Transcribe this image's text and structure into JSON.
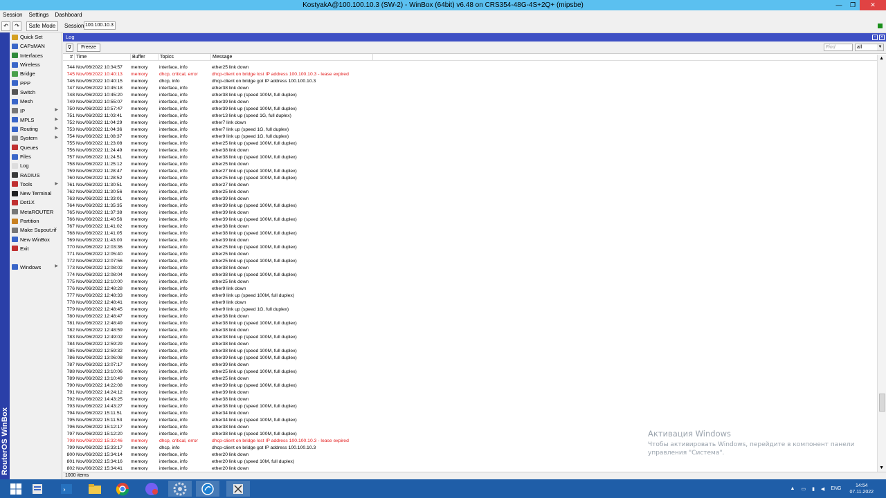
{
  "window": {
    "title": "KostyakA@100.100.10.3 (SW-2) - WinBox (64bit) v6.48 on CRS354-48G-4S+2Q+ (mipsbe)"
  },
  "menubar": [
    "Session",
    "Settings",
    "Dashboard"
  ],
  "toolbar": {
    "undo": "↶",
    "redo": "↷",
    "safe_mode": "Safe Mode",
    "session_label": "Session:",
    "session_value": "100.100.10.3"
  },
  "brand_vertical": "RouterOS WinBox",
  "sidebar": [
    {
      "label": "Quick Set",
      "color": "#d4a020",
      "arrow": false
    },
    {
      "label": "CAPsMAN",
      "color": "#3a66c8",
      "arrow": false
    },
    {
      "label": "Interfaces",
      "color": "#2f8a3a",
      "arrow": false
    },
    {
      "label": "Wireless",
      "color": "#3a66c8",
      "arrow": false
    },
    {
      "label": "Bridge",
      "color": "#4aa04a",
      "arrow": false
    },
    {
      "label": "PPP",
      "color": "#3a66c8",
      "arrow": false
    },
    {
      "label": "Switch",
      "color": "#555555",
      "arrow": false
    },
    {
      "label": "Mesh",
      "color": "#3a66c8",
      "arrow": false
    },
    {
      "label": "IP",
      "color": "#777777",
      "arrow": true
    },
    {
      "label": "MPLS",
      "color": "#3a66c8",
      "arrow": true
    },
    {
      "label": "Routing",
      "color": "#3a66c8",
      "arrow": true
    },
    {
      "label": "System",
      "color": "#888888",
      "arrow": true
    },
    {
      "label": "Queues",
      "color": "#c03030",
      "arrow": false
    },
    {
      "label": "Files",
      "color": "#3a66c8",
      "arrow": false
    },
    {
      "label": "Log",
      "color": "#dddddd",
      "arrow": false
    },
    {
      "label": "RADIUS",
      "color": "#3a3a3a",
      "arrow": false
    },
    {
      "label": "Tools",
      "color": "#c03030",
      "arrow": true
    },
    {
      "label": "New Terminal",
      "color": "#222222",
      "arrow": false
    },
    {
      "label": "Dot1X",
      "color": "#c03030",
      "arrow": false
    },
    {
      "label": "MetaROUTER",
      "color": "#777777",
      "arrow": false
    },
    {
      "label": "Partition",
      "color": "#c88020",
      "arrow": false
    },
    {
      "label": "Make Supout.rif",
      "color": "#777777",
      "arrow": false
    },
    {
      "label": "New WinBox",
      "color": "#3a66c8",
      "arrow": false
    },
    {
      "label": "Exit",
      "color": "#c03030",
      "arrow": false
    },
    {
      "label": "",
      "color": "",
      "arrow": false
    },
    {
      "label": "Windows",
      "color": "#3a66c8",
      "arrow": true
    }
  ],
  "log": {
    "title": "Log",
    "freeze": "Freeze",
    "find_placeholder": "Find",
    "filter_value": "all",
    "columns": [
      "#",
      "Time",
      "Buffer",
      "Topics",
      "Message"
    ],
    "rows": [
      [
        "744",
        "Nov/06/2022 10:34:57",
        "memory",
        "interface, info",
        "ether25  link down",
        false
      ],
      [
        "745",
        "Nov/06/2022 10:40:13",
        "memory",
        "dhcp, critical, error",
        "dhcp-client on bridge lost IP address 100.100.10.3 - lease expired",
        true
      ],
      [
        "746",
        "Nov/06/2022 10:40:15",
        "memory",
        "dhcp, info",
        "dhcp-client on bridge got IP address 100.100.10.3",
        false
      ],
      [
        "747",
        "Nov/06/2022 10:45:18",
        "memory",
        "interface, info",
        "ether38 link down",
        false
      ],
      [
        "748",
        "Nov/06/2022 10:45:20",
        "memory",
        "interface, info",
        "ether38 link up (speed 100M, full duplex)",
        false
      ],
      [
        "749",
        "Nov/06/2022 10:55:07",
        "memory",
        "interface, info",
        "ether39 link down",
        false
      ],
      [
        "750",
        "Nov/06/2022 10:57:47",
        "memory",
        "interface, info",
        "ether39 link up (speed 100M, full duplex)",
        false
      ],
      [
        "751",
        "Nov/06/2022 11:03:41",
        "memory",
        "interface, info",
        "ether13 link up (speed 1G, full duplex)",
        false
      ],
      [
        "752",
        "Nov/06/2022 11:04:29",
        "memory",
        "interface, info",
        "ether7 link down",
        false
      ],
      [
        "753",
        "Nov/06/2022 11:04:36",
        "memory",
        "interface, info",
        "ether7 link up (speed 1G, full duplex)",
        false
      ],
      [
        "754",
        "Nov/06/2022 11:08:37",
        "memory",
        "interface, info",
        "ether9 link up (speed 1G, full duplex)",
        false
      ],
      [
        "755",
        "Nov/06/2022 11:23:08",
        "memory",
        "interface, info",
        "ether25  link up (speed 100M, full duplex)",
        false
      ],
      [
        "756",
        "Nov/06/2022 11:24:49",
        "memory",
        "interface, info",
        "ether38 link down",
        false
      ],
      [
        "757",
        "Nov/06/2022 11:24:51",
        "memory",
        "interface, info",
        "ether38 link up (speed 100M, full duplex)",
        false
      ],
      [
        "758",
        "Nov/06/2022 11:25:12",
        "memory",
        "interface, info",
        "ether25  link down",
        false
      ],
      [
        "759",
        "Nov/06/2022 11:28:47",
        "memory",
        "interface, info",
        "ether27 link up (speed 100M, full duplex)",
        false
      ],
      [
        "760",
        "Nov/06/2022 11:28:52",
        "memory",
        "interface, info",
        "ether25  link up (speed 100M, full duplex)",
        false
      ],
      [
        "761",
        "Nov/06/2022 11:30:51",
        "memory",
        "interface, info",
        "ether27 link down",
        false
      ],
      [
        "762",
        "Nov/06/2022 11:30:56",
        "memory",
        "interface, info",
        "ether25  link down",
        false
      ],
      [
        "763",
        "Nov/06/2022 11:33:01",
        "memory",
        "interface, info",
        "ether39 link down",
        false
      ],
      [
        "764",
        "Nov/06/2022 11:35:35",
        "memory",
        "interface, info",
        "ether39 link up (speed 100M, full duplex)",
        false
      ],
      [
        "765",
        "Nov/06/2022 11:37:38",
        "memory",
        "interface, info",
        "ether39 link down",
        false
      ],
      [
        "766",
        "Nov/06/2022 11:40:56",
        "memory",
        "interface, info",
        "ether39 link up (speed 100M, full duplex)",
        false
      ],
      [
        "767",
        "Nov/06/2022 11:41:02",
        "memory",
        "interface, info",
        "ether38 link down",
        false
      ],
      [
        "768",
        "Nov/06/2022 11:41:05",
        "memory",
        "interface, info",
        "ether38 link up (speed 100M, full duplex)",
        false
      ],
      [
        "769",
        "Nov/06/2022 11:43:00",
        "memory",
        "interface, info",
        "ether39 link down",
        false
      ],
      [
        "770",
        "Nov/06/2022 12:03:36",
        "memory",
        "interface, info",
        "ether25  link up (speed 100M, full duplex)",
        false
      ],
      [
        "771",
        "Nov/06/2022 12:05:40",
        "memory",
        "interface, info",
        "ether25  link down",
        false
      ],
      [
        "772",
        "Nov/06/2022 12:07:56",
        "memory",
        "interface, info",
        "ether25  link up (speed 100M, full duplex)",
        false
      ],
      [
        "773",
        "Nov/06/2022 12:08:02",
        "memory",
        "interface, info",
        "ether38 link down",
        false
      ],
      [
        "774",
        "Nov/06/2022 12:08:04",
        "memory",
        "interface, info",
        "ether38 link up (speed 100M, full duplex)",
        false
      ],
      [
        "775",
        "Nov/06/2022 12:10:00",
        "memory",
        "interface, info",
        "ether25  link down",
        false
      ],
      [
        "776",
        "Nov/06/2022 12:48:28",
        "memory",
        "interface, info",
        "ether9 link down",
        false
      ],
      [
        "777",
        "Nov/06/2022 12:48:33",
        "memory",
        "interface, info",
        "ether9 link up (speed 100M, full duplex)",
        false
      ],
      [
        "778",
        "Nov/06/2022 12:48:41",
        "memory",
        "interface, info",
        "ether9 link down",
        false
      ],
      [
        "779",
        "Nov/06/2022 12:48:45",
        "memory",
        "interface, info",
        "ether9 link up (speed 1G, full duplex)",
        false
      ],
      [
        "780",
        "Nov/06/2022 12:48:47",
        "memory",
        "interface, info",
        "ether38 link down",
        false
      ],
      [
        "781",
        "Nov/06/2022 12:48:49",
        "memory",
        "interface, info",
        "ether38 link up (speed 100M, full duplex)",
        false
      ],
      [
        "782",
        "Nov/06/2022 12:48:59",
        "memory",
        "interface, info",
        "ether38 link down",
        false
      ],
      [
        "783",
        "Nov/06/2022 12:49:02",
        "memory",
        "interface, info",
        "ether38 link up (speed 100M, full duplex)",
        false
      ],
      [
        "784",
        "Nov/06/2022 12:59:29",
        "memory",
        "interface, info",
        "ether38 link down",
        false
      ],
      [
        "785",
        "Nov/06/2022 12:59:32",
        "memory",
        "interface, info",
        "ether38 link up (speed 100M, full duplex)",
        false
      ],
      [
        "786",
        "Nov/06/2022 13:06:08",
        "memory",
        "interface, info",
        "ether39 link up (speed 100M, full duplex)",
        false
      ],
      [
        "787",
        "Nov/06/2022 13:07:17",
        "memory",
        "interface, info",
        "ether39 link down",
        false
      ],
      [
        "788",
        "Nov/06/2022 13:10:06",
        "memory",
        "interface, info",
        "ether25  link up (speed 100M, full duplex)",
        false
      ],
      [
        "789",
        "Nov/06/2022 13:10:49",
        "memory",
        "interface, info",
        "ether25  link down",
        false
      ],
      [
        "790",
        "Nov/06/2022 14:22:08",
        "memory",
        "interface, info",
        "ether39 link up (speed 100M, full duplex)",
        false
      ],
      [
        "791",
        "Nov/06/2022 14:24:12",
        "memory",
        "interface, info",
        "ether39 link down",
        false
      ],
      [
        "792",
        "Nov/06/2022 14:43:25",
        "memory",
        "interface, info",
        "ether38 link down",
        false
      ],
      [
        "793",
        "Nov/06/2022 14:43:27",
        "memory",
        "interface, info",
        "ether38 link up (speed 100M, full duplex)",
        false
      ],
      [
        "794",
        "Nov/06/2022 15:11:51",
        "memory",
        "interface, info",
        "ether34 link down",
        false
      ],
      [
        "795",
        "Nov/06/2022 15:11:53",
        "memory",
        "interface, info",
        "ether34 link up (speed 100M, full duplex)",
        false
      ],
      [
        "796",
        "Nov/06/2022 15:12:17",
        "memory",
        "interface, info",
        "ether38 link down",
        false
      ],
      [
        "797",
        "Nov/06/2022 15:12:20",
        "memory",
        "interface, info",
        "ether38 link up (speed 100M, full duplex)",
        false
      ],
      [
        "798",
        "Nov/06/2022 15:32:46",
        "memory",
        "dhcp, critical, error",
        "dhcp-client on bridge lost IP address 100.100.10.3 - lease expired",
        true
      ],
      [
        "799",
        "Nov/06/2022 15:33:17",
        "memory",
        "dhcp, info",
        "dhcp-client on bridge got IP address 100.100.10.3",
        false
      ],
      [
        "800",
        "Nov/06/2022 15:34:14",
        "memory",
        "interface, info",
        "ether20 link down",
        false
      ],
      [
        "801",
        "Nov/06/2022 15:34:16",
        "memory",
        "interface, info",
        "ether20 link up (speed 10M, full duplex)",
        false
      ],
      [
        "802",
        "Nov/06/2022 15:34:41",
        "memory",
        "interface, info",
        "ether20 link down",
        false
      ]
    ],
    "status": "1000 items"
  },
  "watermark": {
    "line1": "Активация Windows",
    "line2": "Чтобы активировать Windows, перейдите в компонент панели",
    "line3": "управления \"Система\"."
  },
  "taskbar": {
    "lang": "ENG",
    "time": "14:54",
    "date": "07.11.2022"
  },
  "colors": {
    "title_bar": "#5bc0f0",
    "log_title": "#3d4fc4",
    "error_text": "#e21a1a",
    "sidebar_strip": "#2a3fa8",
    "taskbar": "#1f5ea8"
  }
}
